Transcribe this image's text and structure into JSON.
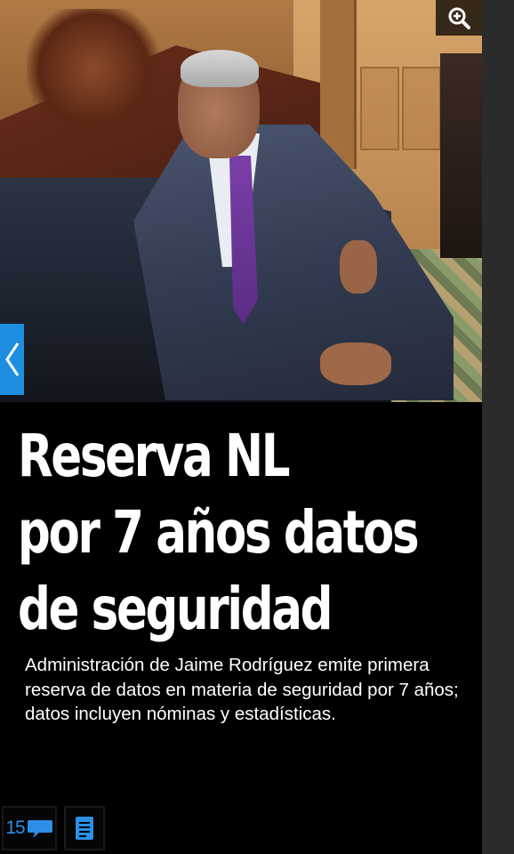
{
  "headline": {
    "line1": "Reserva NL",
    "line2": "por 7 años datos",
    "line3": "de seguridad"
  },
  "subtitle": "Administración de Jaime Rodríguez emite primera reserva de datos en materia de seguridad por 7 años; datos incluyen nóminas y estadísticas.",
  "toolbar": {
    "comments_count": "15"
  },
  "icons": {
    "zoom": "zoom-in-icon",
    "prev": "chevron-left-icon",
    "comments": "speech-bubble-icon",
    "article": "document-icon"
  },
  "colors": {
    "accent": "#1e8ee0",
    "background": "#000000",
    "text": "#ffffff"
  }
}
